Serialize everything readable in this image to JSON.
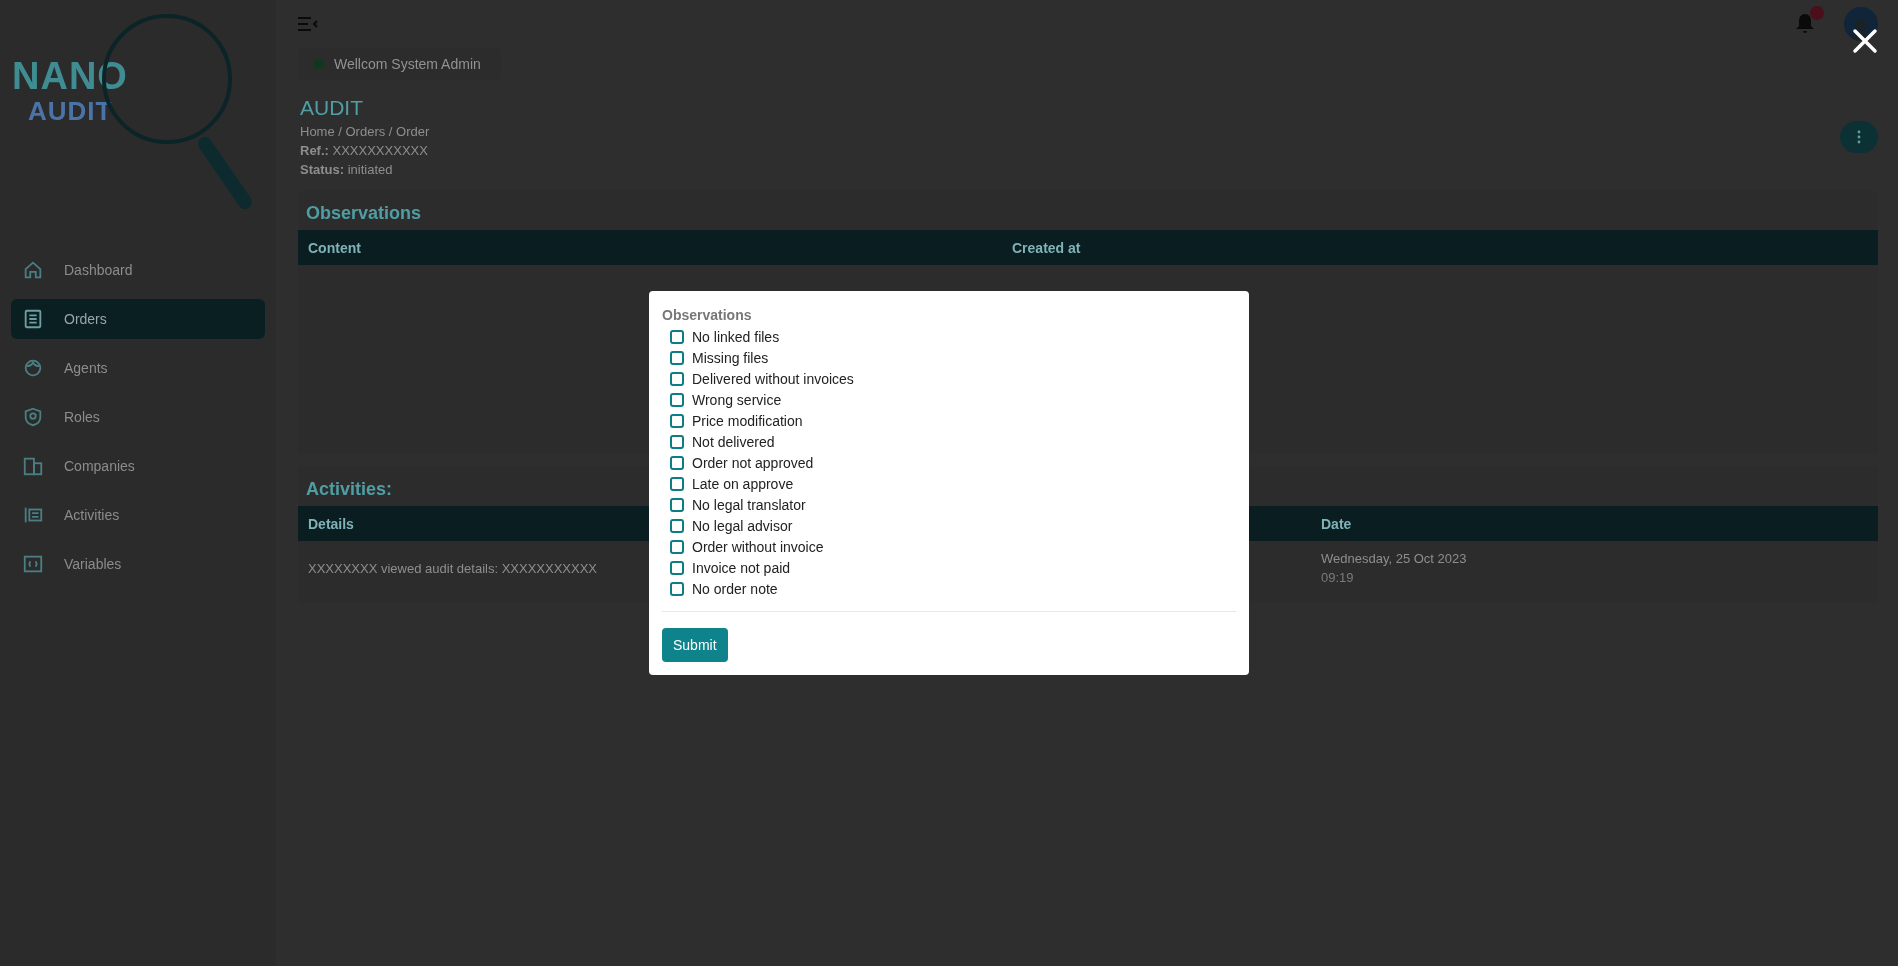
{
  "sidebar": {
    "logo": {
      "line_1": "NANO",
      "line_2": "AUDIT"
    },
    "items": [
      {
        "label": "Dashboard",
        "selected": false
      },
      {
        "label": "Orders",
        "selected": true
      },
      {
        "label": "Agents",
        "selected": false
      },
      {
        "label": "Roles",
        "selected": false
      },
      {
        "label": "Companies",
        "selected": false
      },
      {
        "label": "Activities",
        "selected": false
      },
      {
        "label": "Variables",
        "selected": false
      }
    ]
  },
  "header": {
    "welcome": "Wellcom System Admin",
    "notifications_unread": true
  },
  "page": {
    "title": "AUDIT",
    "breadcrumb": "Home / Orders / Order",
    "ref_label": "Ref.:",
    "ref_value": "XXXXXXXXXXX",
    "status_label": "Status:",
    "status_value": "initiated"
  },
  "observations": {
    "title": "Observations",
    "columns": [
      "Content",
      "Created at"
    ]
  },
  "activities": {
    "title": "Activities:",
    "columns": [
      "Details",
      "Date"
    ],
    "rows": [
      {
        "details": "XXXXXXXX viewed audit details: XXXXXXXXXXX",
        "date": "Wednesday, 25 Oct 2023",
        "time": "09:19"
      }
    ]
  },
  "modal": {
    "label": "Observations",
    "options": [
      {
        "label": "No linked files",
        "checked": false
      },
      {
        "label": "Missing files",
        "checked": false
      },
      {
        "label": "Delivered without invoices",
        "checked": false
      },
      {
        "label": "Wrong service",
        "checked": false
      },
      {
        "label": "Price modification",
        "checked": false
      },
      {
        "label": "Not delivered",
        "checked": false
      },
      {
        "label": "Order not approved",
        "checked": false
      },
      {
        "label": "Late on approve",
        "checked": false
      },
      {
        "label": "No legal translator",
        "checked": false
      },
      {
        "label": "No legal advisor",
        "checked": false
      },
      {
        "label": "Order without invoice",
        "checked": false
      },
      {
        "label": "Invoice not paid",
        "checked": false
      },
      {
        "label": "No order note",
        "checked": false
      }
    ],
    "submit": "Submit"
  }
}
